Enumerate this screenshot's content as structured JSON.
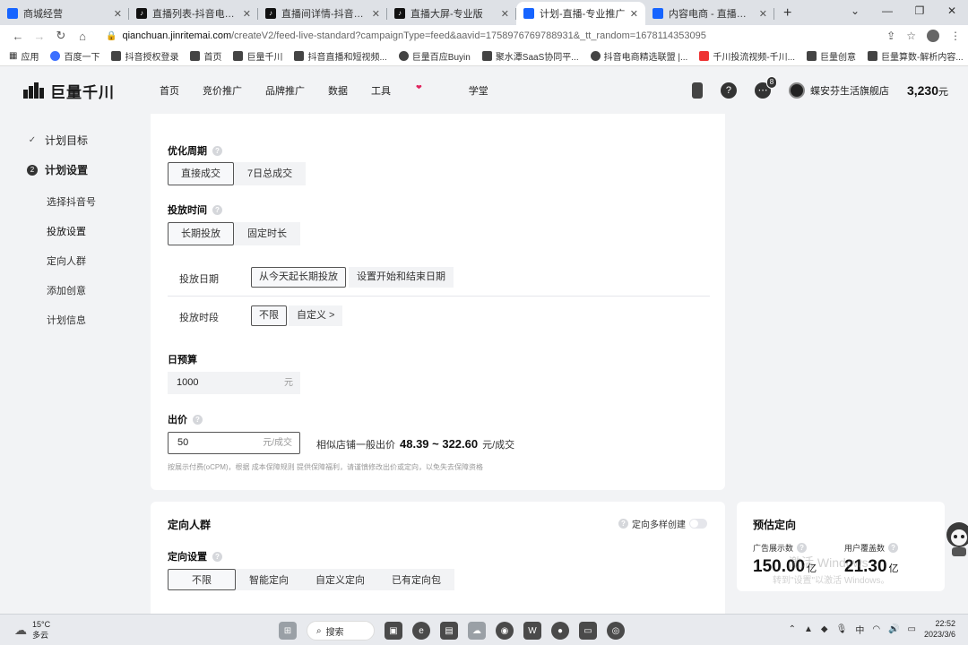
{
  "browser": {
    "tabs": [
      {
        "title": "商城经营",
        "icon": "q",
        "active": false
      },
      {
        "title": "直播列表-抖音电商罗盘",
        "icon": "d",
        "active": false
      },
      {
        "title": "直播间详情-抖音电商罗",
        "icon": "d",
        "active": false
      },
      {
        "title": "直播大屏-专业版",
        "icon": "d",
        "active": false
      },
      {
        "title": "计划-直播-专业推广",
        "icon": "q",
        "active": true
      },
      {
        "title": "内容电商 - 直播引流创",
        "icon": "q",
        "active": false
      }
    ],
    "new_tab": "+",
    "url_domain": "qianchuan.jinritemai.com",
    "url_rest": "/createV2/feed-live-standard?campaignType=feed&aavid=1758976769788931&_tt_random=1678114353095",
    "bookmarks": [
      "应用",
      "百度一下",
      "抖音授权登录",
      "首页",
      "巨量千川",
      "抖音直播和短视频...",
      "巨量百应Buyin",
      "聚水潭SaaS协同平...",
      "抖音电商精选联盟 |...",
      "千川投流视频-千川...",
      "巨量创意",
      "巨量算数-解析内容..."
    ]
  },
  "header": {
    "logo": "巨量千川",
    "nav": [
      "首页",
      "竞价推广",
      "品牌推广",
      "数据",
      "工具",
      "学堂"
    ],
    "message_badge": "8",
    "shop_name": "蝶安芬生活旗舰店",
    "balance": "3,230",
    "balance_unit": "元"
  },
  "sidebar": {
    "step1": "计划目标",
    "step2": "计划设置",
    "items": [
      "选择抖音号",
      "投放设置",
      "定向人群",
      "添加创意",
      "计划信息"
    ]
  },
  "settings": {
    "opt_period_label": "优化周期",
    "opt_period_options": [
      "直接成交",
      "7日总成交"
    ],
    "delivery_time_label": "投放时间",
    "delivery_time_options": [
      "长期投放",
      "固定时长"
    ],
    "delivery_date_label": "投放日期",
    "delivery_date_options": [
      "从今天起长期投放",
      "设置开始和结束日期"
    ],
    "delivery_slot_label": "投放时段",
    "delivery_slot_options": [
      "不限",
      "自定义 >"
    ],
    "budget_label": "日预算",
    "budget_value": "1000",
    "budget_unit": "元",
    "bid_label": "出价",
    "bid_value": "50",
    "bid_unit": "元/成交",
    "bid_ref_prefix": "相似店铺一般出价",
    "bid_ref_range": "48.39 ~ 322.60",
    "bid_ref_unit": "元/成交",
    "bid_note": "按展示付费(oCPM)，根据  成本保障规则  提供保障福利，请谨慎修改出价或定向，以免失去保障资格"
  },
  "targeting": {
    "title": "定向人群",
    "multi_label": "定向多样创建",
    "setting_label": "定向设置",
    "options": [
      "不限",
      "智能定向",
      "自定义定向",
      "已有定向包"
    ]
  },
  "estimate": {
    "title": "预估定向",
    "impressions_label": "广告展示数",
    "impressions_value": "150.00",
    "impressions_unit": "亿",
    "coverage_label": "用户覆盖数",
    "coverage_value": "21.30",
    "coverage_unit": "亿",
    "watermark1": "激活 Windows",
    "watermark2": "转到\"设置\"以激活 Windows。"
  },
  "taskbar": {
    "temp": "15°C",
    "weather": "多云",
    "search": "搜索",
    "ime": "中",
    "time": "22:52",
    "date": "2023/3/6"
  }
}
